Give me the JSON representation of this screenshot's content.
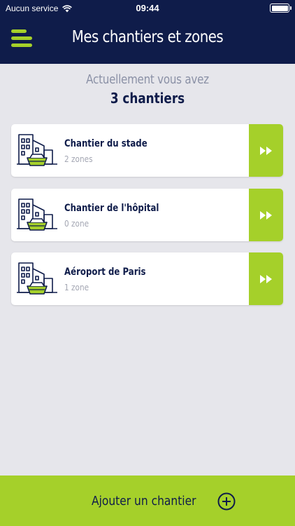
{
  "status_bar": {
    "carrier": "Aucun service",
    "time": "09:44",
    "wifi_icon": "wifi-icon",
    "battery_icon": "battery-icon"
  },
  "header": {
    "title": "Mes chantiers et zones",
    "menu_icon": "hamburger-menu-icon"
  },
  "summary": {
    "line1": "Actuellement vous avez",
    "line2": "3 chantiers"
  },
  "sites": [
    {
      "name": "Chantier du stade",
      "zones": "2 zones",
      "icon": "building-site-icon",
      "action_icon": "fast-forward-icon"
    },
    {
      "name": "Chantier de l'hôpital",
      "zones": "0 zone",
      "icon": "building-site-icon",
      "action_icon": "fast-forward-icon"
    },
    {
      "name": "Aéroport de Paris",
      "zones": "1 zone",
      "icon": "building-site-icon",
      "action_icon": "fast-forward-icon"
    }
  ],
  "footer": {
    "add_label": "Ajouter un chantier",
    "add_icon": "plus-circle-icon"
  },
  "colors": {
    "navy": "#0f1c4a",
    "lime": "#a5d02a",
    "background": "#e6e6eb",
    "muted_text": "#8b91a6"
  }
}
